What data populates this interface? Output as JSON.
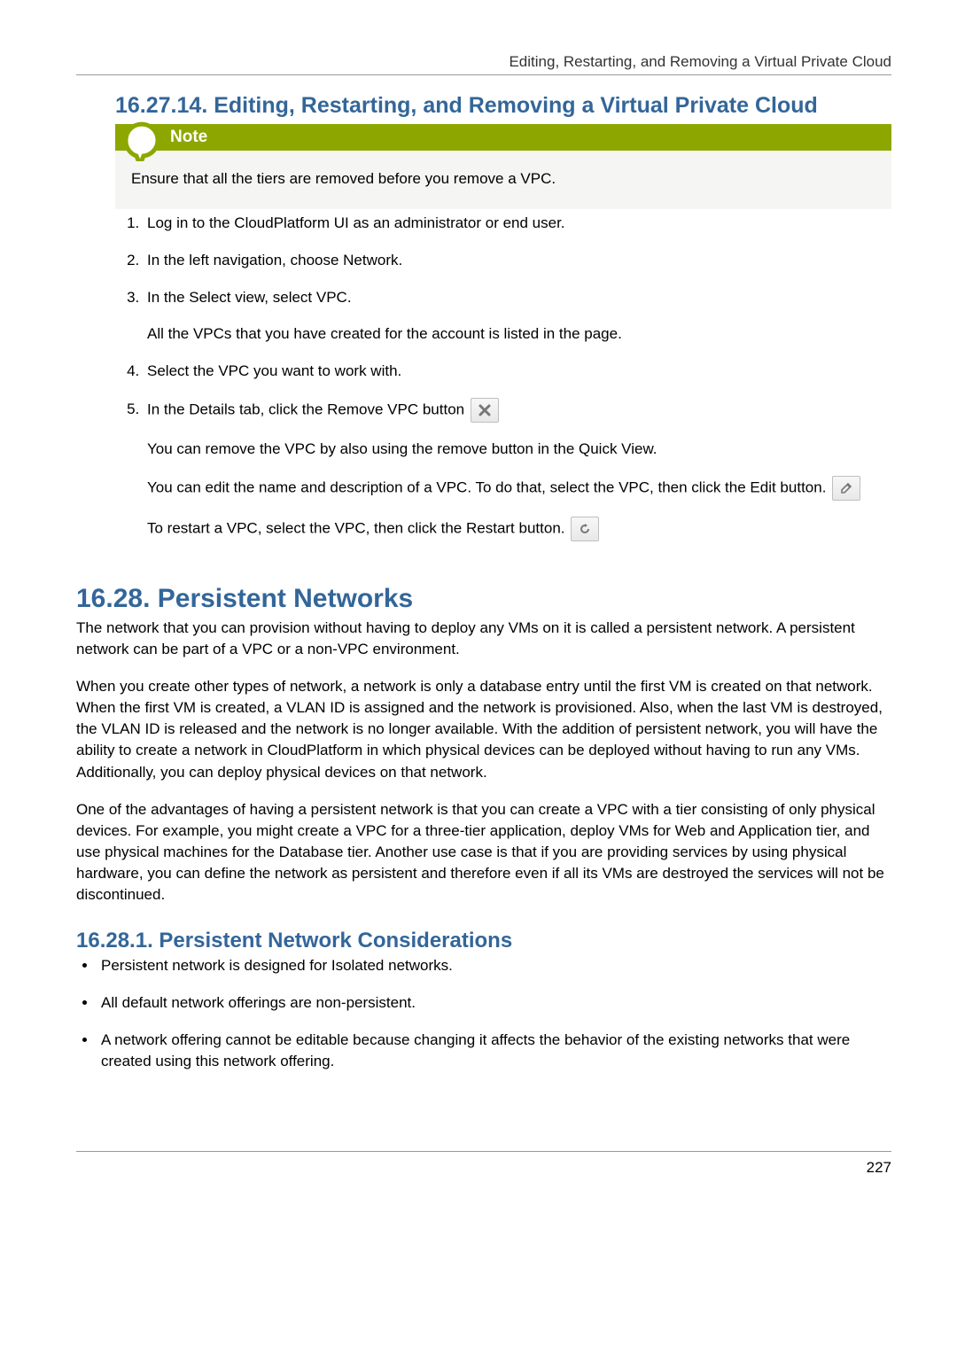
{
  "header": {
    "breadcrumb": "Editing, Restarting, and Removing a Virtual Private Cloud"
  },
  "section_1": {
    "heading": "16.27.14. Editing, Restarting, and Removing a Virtual Private Cloud",
    "note_label": "Note",
    "note_body": "Ensure that all the tiers are removed before you remove a VPC.",
    "steps": {
      "s1": "Log in to the CloudPlatform UI as an administrator or end user.",
      "s2": "In the left navigation, choose Network.",
      "s3": "In the Select view, select VPC.",
      "s3b": "All the VPCs that you have created for the account is listed in the page.",
      "s4": "Select the VPC you want to work with.",
      "s5a": "In the Details tab, click the Remove VPC button",
      "s5b": "You can remove the VPC by also using the remove button in the Quick View.",
      "s5c": "You can edit the name and description of a VPC. To do that, select the VPC, then click the Edit button.",
      "s5d": "To restart a VPC, select the VPC, then click the Restart button."
    }
  },
  "section_2": {
    "heading": "16.28. Persistent Networks",
    "p1": "The network that you can provision without having to deploy any VMs on it is called a persistent network. A persistent network can be part of a VPC or a non-VPC environment.",
    "p2": "When you create other types of network, a network is only a database entry until the first VM is created on that network. When the first VM is created, a VLAN ID is assigned and the network is provisioned. Also, when the last VM is destroyed, the VLAN ID is released and the network is no longer available. With the addition of persistent network, you will have the ability to create a network in CloudPlatform in which physical devices can be deployed without having to run any VMs. Additionally, you can deploy physical devices on that network.",
    "p3": "One of the advantages of having a persistent network is that you can create a VPC with a tier consisting of only physical devices. For example, you might create a VPC for a three-tier application, deploy VMs for Web and Application tier, and use physical machines for the Database tier. Another use case is that if you are providing services by using physical hardware, you can define the network as persistent and therefore even if all its VMs are destroyed the services will not be discontinued."
  },
  "section_3": {
    "heading": "16.28.1. Persistent Network Considerations",
    "b1": "Persistent network is designed for Isolated networks.",
    "b2": "All default network offerings are non-persistent.",
    "b3": "A network offering cannot be editable because changing it affects the behavior of the existing networks that were created using this network offering."
  },
  "footer": {
    "page_number": "227"
  }
}
